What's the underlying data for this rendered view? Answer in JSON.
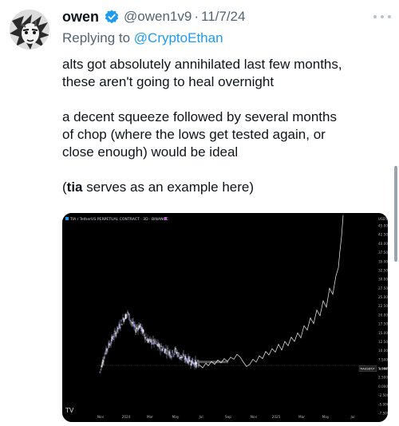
{
  "post": {
    "author_name": "owen",
    "handle": "@owen1v9",
    "separator": "·",
    "date": "11/7/24",
    "reply_prefix": "Replying to ",
    "reply_handle": "@CryptoEthan",
    "line1": "alts got absolutely annihilated last few months,",
    "line2": "these aren't going to heal overnight",
    "line3": "a decent squeeze followed by several months",
    "line4": "of chop (where the lows get tested again, or",
    "line5": "close enough) would be ideal",
    "line6_open": "(",
    "line6_ticker": "tia",
    "line6_rest": " serves as an example here)"
  },
  "chart": {
    "header": "TIA / TetherUS PERPETUAL CONTRACT · 3D · BINANCE",
    "axis_label": "USDT",
    "price_ticks": [
      "45.0000",
      "42.5000",
      "40.0000",
      "37.5000",
      "35.0000",
      "32.5000",
      "30.0000",
      "27.5000",
      "25.0000",
      "22.5000",
      "20.0000",
      "17.5000",
      "15.0000",
      "12.5000",
      "10.0000",
      "7.5000",
      "5.0000",
      "2.5000",
      "0.0000",
      "-2.5000",
      "-5.0000",
      "-7.5000"
    ],
    "date_ticks": [
      "Nov",
      "2024",
      "Mar",
      "May",
      "Jul",
      "Sep",
      "Nov",
      "2025",
      "Mar",
      "May",
      "Jul"
    ],
    "price_tag": "TIAUSDT.P",
    "price_tag_value": "4.9887",
    "logo": "TV"
  },
  "colors": {
    "accent": "#1d9bf0",
    "bullish": "#b8b4f0",
    "bearish": "#ffffff",
    "chart_bg": "#000000"
  },
  "icons": [
    "verified-badge-icon",
    "more-icon"
  ]
}
